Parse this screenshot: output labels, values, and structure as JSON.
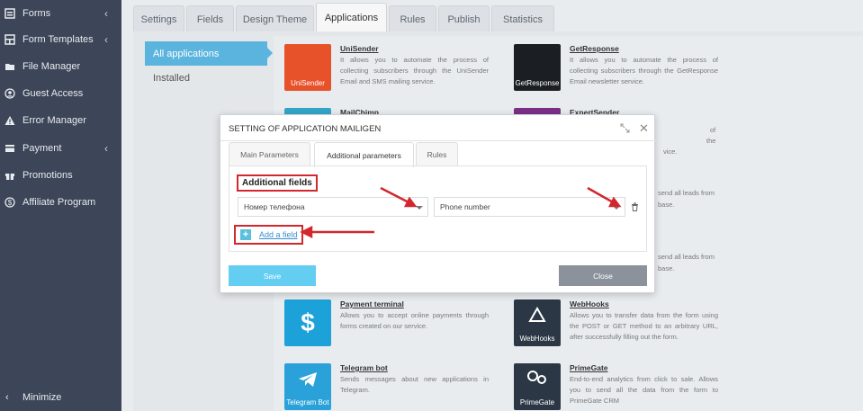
{
  "sidebar": {
    "items": [
      {
        "label": "Forms",
        "icon": "forms-icon",
        "has_chevron": true
      },
      {
        "label": "Form Templates",
        "icon": "template-icon",
        "has_chevron": true
      },
      {
        "label": "File Manager",
        "icon": "folder-icon",
        "has_chevron": false
      },
      {
        "label": "Guest Access",
        "icon": "user-icon",
        "has_chevron": false
      },
      {
        "label": "Error Manager",
        "icon": "warning-icon",
        "has_chevron": false
      },
      {
        "label": "Payment",
        "icon": "payment-icon",
        "has_chevron": true
      },
      {
        "label": "Promotions",
        "icon": "gift-icon",
        "has_chevron": false
      },
      {
        "label": "Affiliate Program",
        "icon": "dollar-icon",
        "has_chevron": false
      }
    ],
    "minimize_label": "Minimize"
  },
  "tabs": [
    {
      "label": "Settings"
    },
    {
      "label": "Fields"
    },
    {
      "label": "Design Theme"
    },
    {
      "label": "Applications",
      "active": true
    },
    {
      "label": "Rules"
    },
    {
      "label": "Publish"
    },
    {
      "label": "Statistics"
    }
  ],
  "left_menu": [
    {
      "label": "All applications",
      "active": true
    },
    {
      "label": "Installed"
    }
  ],
  "apps": [
    {
      "name": "UniSender",
      "desc": "It allows you to automate the process of collecting subscribers through the UniSender Email and SMS mailing service.",
      "logo_text": "UniSender",
      "color": "#e8522a"
    },
    {
      "name": "GetResponse",
      "desc": "It allows you to automate the process of collecting subscribers through the GetResponse Email newsletter service.",
      "logo_text": "GetResponse",
      "color": "#1b1f23"
    },
    {
      "name": "MailChimp",
      "desc": "",
      "logo_text": "",
      "color": "#33a5c8"
    },
    {
      "name": "ExpertSender",
      "desc": "through the",
      "logo_text": "",
      "color": "#7b2f87"
    },
    {
      "name": "Payment terminal",
      "desc": "Allows you to accept online payments through forms created on our service.",
      "logo_text": "$",
      "color": "#1da1d9"
    },
    {
      "name": "WebHooks",
      "desc": "Allows you to transfer data from the form using the POST or GET method to an arbitrary URL, after successfully filling out the form.",
      "logo_text": "WebHooks",
      "color": "#2b3745"
    },
    {
      "name": "Telegram bot",
      "desc": "Sends messages about new applications in Telegram.",
      "logo_text": "Telegram Bot",
      "color": "#2aa2d9"
    },
    {
      "name": "PrimeGate",
      "desc": "End-to-end analytics from click to sale. Allows you to send all the data from the form to PrimeGate CRM",
      "logo_text": "PrimeGate",
      "color": "#2b3745"
    }
  ],
  "partial_texts": {
    "right_col_1": "of",
    "right_col_2": "the",
    "right_col_3": "vice.",
    "right_col_4": "send all leads from",
    "right_col_5": "base.",
    "right_col_6": "send all leads from",
    "right_col_7": "base."
  },
  "modal": {
    "title": "SETTING OF APPLICATION MAILIGEN",
    "tabs": [
      {
        "label": "Main Parameters"
      },
      {
        "label": "Additional parameters",
        "active": true
      },
      {
        "label": "Rules"
      }
    ],
    "section_title": "Additional fields",
    "field_select_value": "Номер телефона",
    "param_select_value": "Phone number",
    "add_field_label": "Add a field",
    "save_label": "Save",
    "close_label": "Close"
  },
  "colors": {
    "sidebar_bg": "#3c4658",
    "accent_blue": "#5bb4de",
    "highlight_red": "#d1282e",
    "save_btn": "#64cdf2",
    "close_btn": "#8b929b"
  }
}
